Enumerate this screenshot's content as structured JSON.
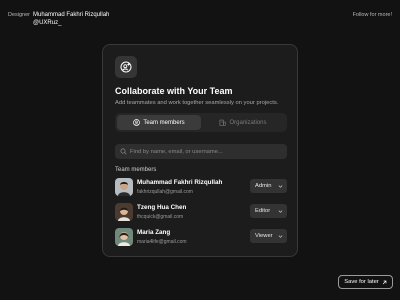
{
  "header": {
    "designer_label": "Designer",
    "designer_name": "Muhammad Fakhri Rizqullah",
    "designer_handle": "@UXRuz_",
    "follow_label": "Follow for more!"
  },
  "card": {
    "icon": "user-plus-icon",
    "title": "Collaborate with Your Team",
    "subtitle": "Add teammates and work together seamlessly on your projects.",
    "tabs": [
      {
        "label": "Team members",
        "icon": "user-circle-icon",
        "active": true
      },
      {
        "label": "Organizations",
        "icon": "building-icon",
        "active": false
      }
    ],
    "search": {
      "placeholder": "Find by name, email, or username..."
    },
    "section_label": "Team members",
    "members": [
      {
        "name": "Muhammad Fakhri Rizqullah",
        "email": "fakhrizqullah@gmail.com",
        "role": "Admin"
      },
      {
        "name": "Tzeng Hua Chen",
        "email": "thcquick@gmail.com",
        "role": "Editor"
      },
      {
        "name": "Maria Zang",
        "email": "maria4life@gmail.com",
        "role": "Viewer"
      }
    ]
  },
  "save_button": {
    "label": "Save for later",
    "icon": "arrow-up-right-icon"
  },
  "colors": {
    "background": "#121212",
    "card": "#1c1c1c",
    "card_border": "#383838",
    "text_primary": "#ffffff",
    "text_muted": "#a8a8a8"
  }
}
